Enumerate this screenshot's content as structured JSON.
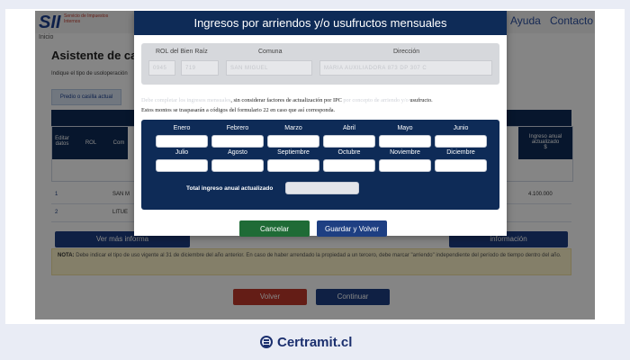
{
  "site": {
    "logo_text": "SII",
    "logo_sub": "Servicio de Impuestos Internos",
    "breadcrumb": "Inicio",
    "nav": [
      "Ayuda",
      "Contacto"
    ]
  },
  "background": {
    "title": "Asistente de ca",
    "hint": "Indique el tipo de usoloperación",
    "chip": "Predio o casilla actual",
    "col_editar": "Editar datos",
    "col_rol": "ROL",
    "col_comuna": "Com",
    "col_ingreso": "Ingreso anual actualizado",
    "col_ingreso_unit": "$",
    "rows": [
      {
        "num": "1",
        "comuna": "SAN M",
        "ingreso": "4.100.000"
      },
      {
        "num": "2",
        "comuna": "LITUE",
        "ingreso": ""
      }
    ],
    "btn_ver_mas": "Ver más informa",
    "btn_informacion": "información",
    "nota_label": "NOTA:",
    "nota_text": "Debe indicar el tipo de uso vigente al 31 de diciembre del año anterior. En caso de haber arrendado la propiedad a un tercero, debe marcar \"arriendo\" independiente del período de tiempo dentro del año.",
    "btn_volver": "Volver",
    "btn_continuar": "Continuar"
  },
  "modal": {
    "title": "Ingresos por arriendos y/o usufructos mensuales",
    "property": {
      "labels": {
        "rol": "ROL del Bien Raíz",
        "comuna": "Comuna",
        "direccion": "Dirección"
      },
      "values": {
        "rol_a": "0945",
        "rol_b": "719",
        "comuna": "SAN MIGUEL",
        "direccion": "MARIA AUXILIADORA 873 DP 307 C"
      }
    },
    "info_blur_1": "Debe completar los ingresos mensuales",
    "info_text_1": ", sin considerar factores de actualización por IPC",
    "info_blur_2": " por concepto de arriendo y/o",
    "info_text_2": " usufructo.",
    "info_line_2": "Estos montos se traspasarán a códigos del formulario 22 en caso que así corresponda.",
    "months_row1": [
      "Enero",
      "Febrero",
      "Marzo",
      "Abril",
      "Mayo",
      "Junio"
    ],
    "months_row2": [
      "Julio",
      "Agosto",
      "Septiembre",
      "Octubre",
      "Noviembre",
      "Diciembre"
    ],
    "total_label": "Total ingreso anual actualizado",
    "total_value": "",
    "btn_cancelar": "Cancelar",
    "btn_guardar": "Guardar y Volver"
  },
  "brand": {
    "name": "Certramit.cl",
    "color": "#1b2f6e"
  },
  "colors": {
    "navy": "#0e2b57",
    "green": "#1f6b36",
    "blue": "#1e3f82",
    "red": "#c0392b"
  }
}
